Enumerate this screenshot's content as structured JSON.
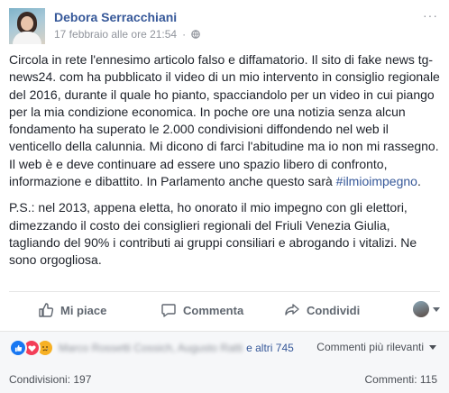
{
  "header": {
    "author": "Debora Serracchiani",
    "timestamp": "17 febbraio alle ore 21:54",
    "separator": "·",
    "privacy_icon": "globe-icon",
    "more_label": "···"
  },
  "post": {
    "paragraph1": "Circola in rete l'ennesimo articolo falso e diffamatorio. Il sito di fake news tg-news24. com ha pubblicato il video di un mio intervento in consiglio regionale del 2016, durante il quale ho pianto, spacciandolo per un video in cui piango per la mia condizione economica. In poche ore una notizia senza alcun fondamento ha superato le 2.000 condivisioni diffondendo nel web il venticello della calunnia. Mi dicono di farci l'abitudine ma io non mi rassegno. Il web è e deve continuare ad essere uno spazio libero di confronto, informazione e dibattito. In Parlamento anche questo sarà",
    "hashtag": "#ilmioimpegno",
    "paragraph1_end": ".",
    "paragraph2": "P.S.: nel 2013, appena eletta, ho onorato il mio impegno con gli elettori, dimezzando il costo dei consiglieri regionali del Friuli Venezia Giulia, tagliando del 90% i contributi ai gruppi consiliari e abrogando i vitalizi. Ne sono orgogliosa."
  },
  "actions": {
    "like_label": "Mi piace",
    "comment_label": "Commenta",
    "share_label": "Condividi"
  },
  "footer": {
    "reaction_icons": [
      "like-reaction-icon",
      "love-reaction-icon",
      "sad-reaction-icon"
    ],
    "names_blurred": "Marco Rossetti Cossich, Augusto Ratti",
    "others_label": "e altri 745",
    "sort_label": "Commenti più rilevanti",
    "shares_label": "Condivisioni: 197",
    "comments_label": "Commenti: 115"
  },
  "colors": {
    "link": "#365899",
    "meta": "#90949c",
    "text": "#1d2129",
    "like_reaction": "#1877f2",
    "love_reaction": "#f33e58",
    "sad_reaction": "#f7b125"
  }
}
